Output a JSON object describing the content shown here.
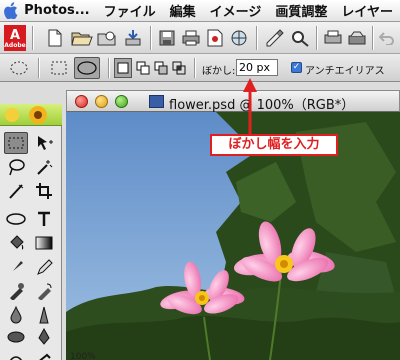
{
  "menubar": {
    "app_name": "Photos...",
    "items": [
      "ファイル",
      "編集",
      "イメージ",
      "画質調整",
      "レイヤー"
    ]
  },
  "toolbar": {
    "logo_letter": "A",
    "logo_text": "Adobe"
  },
  "options_bar": {
    "feather_label": "ぼかし:",
    "feather_value": "20 px",
    "antialias_label": "アンチエイリアス",
    "antialias_checked": true
  },
  "document": {
    "title": "flower.psd @ 100%（RGB*）",
    "zoom_readout": "100%"
  },
  "annotation": {
    "text": "ぼかし幅を入力",
    "color": "#e02020"
  },
  "colors": {
    "sky": "#6f97c9",
    "foliage": "#2f4f1e",
    "flower": "#f07fb8",
    "accent_red": "#e02020"
  }
}
